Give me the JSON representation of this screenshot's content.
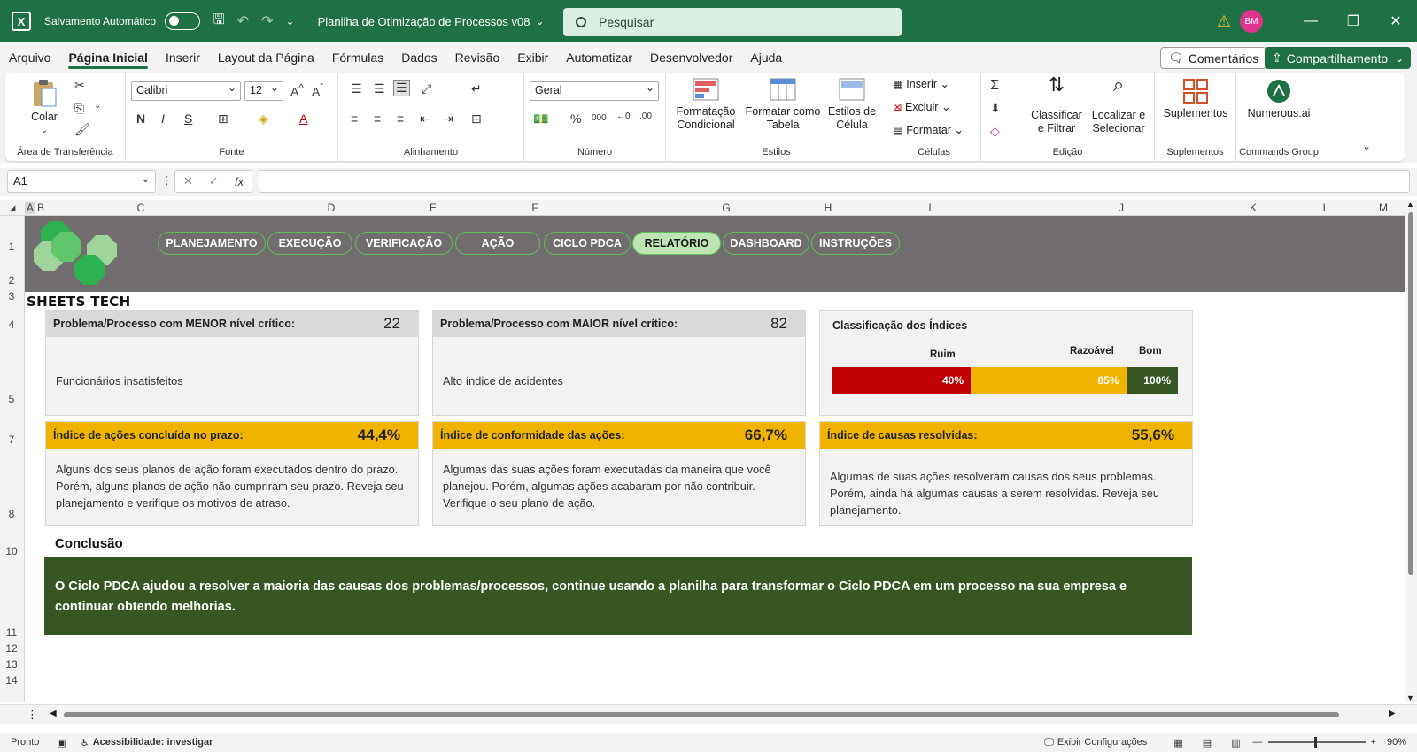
{
  "titlebar": {
    "autosave_label": "Salvamento Automático",
    "title": "Planilha de Otimização de Processos v08",
    "search_placeholder": "Pesquisar",
    "avatar_initials": "BM"
  },
  "menu": {
    "tabs": [
      "Arquivo",
      "Página Inicial",
      "Inserir",
      "Layout da Página",
      "Fórmulas",
      "Dados",
      "Revisão",
      "Exibir",
      "Automatizar",
      "Desenvolvedor",
      "Ajuda"
    ],
    "active": "Página Inicial",
    "comments": "Comentários",
    "share": "Compartilhamento"
  },
  "ribbon": {
    "clipboard": {
      "paste": "Colar",
      "label": "Área de Transferência"
    },
    "font": {
      "name": "Calibri",
      "size": "12",
      "bold": "N",
      "italic": "I",
      "underline": "S",
      "label": "Fonte"
    },
    "alignment": {
      "label": "Alinhamento"
    },
    "number": {
      "format": "Geral",
      "label": "Número"
    },
    "styles": {
      "conditional_1": "Formatação",
      "conditional_2": "Condicional",
      "table_1": "Formatar como",
      "table_2": "Tabela",
      "cell_1": "Estilos de",
      "cell_2": "Célula",
      "label": "Estilos"
    },
    "cells": {
      "insert": "Inserir",
      "delete": "Excluir",
      "format": "Formatar",
      "label": "Células"
    },
    "editing": {
      "sort_1": "Classificar",
      "sort_2": "e Filtrar",
      "find_1": "Localizar e",
      "find_2": "Selecionar",
      "label": "Edição"
    },
    "addins": {
      "btn": "Suplementos",
      "label": "Suplementos"
    },
    "commands": {
      "btn": "Numerous.ai",
      "label": "Commands Group"
    }
  },
  "formula_bar": {
    "name_box": "A1",
    "fx": "fx",
    "content": ""
  },
  "columns": [
    "A",
    "B",
    "C",
    "D",
    "E",
    "F",
    "G",
    "H",
    "I",
    "J",
    "K",
    "L",
    "M"
  ],
  "rows": [
    "1",
    "2",
    "3",
    "4",
    "5",
    "7",
    "8",
    "10",
    "11",
    "12",
    "13",
    "14"
  ],
  "sheet": {
    "brand": "SHEETS TECH",
    "nav": [
      "PLANEJAMENTO",
      "EXECUÇÃO",
      "VERIFICAÇÃO",
      "AÇÃO",
      "CICLO PDCA",
      "RELATÓRIO",
      "DASHBOARD",
      "INSTRUÇÕES"
    ],
    "nav_active": "RELATÓRIO",
    "min_card": {
      "title": "Problema/Processo com MENOR nível crítico:",
      "value": "22",
      "text": "Funcionários insatisfeitos"
    },
    "max_card": {
      "title": "Problema/Processo com MAIOR nível crítico:",
      "value": "82",
      "text": "Alto índice de acidentes"
    },
    "scale": {
      "title": "Classificação dos Índices",
      "labels": [
        "Ruim",
        "Razoável",
        "Bom"
      ],
      "segments": [
        {
          "value": "40%",
          "fraction": 0.4,
          "color": "#c00000"
        },
        {
          "value": "85%",
          "fraction": 0.85,
          "color": "#f0b400"
        },
        {
          "value": "100%",
          "fraction": 1.0,
          "color": "#375623"
        }
      ]
    },
    "kpi1": {
      "title": "Índice de ações concluída no prazo:",
      "value": "44,4%",
      "text": "Alguns dos seus planos de ação foram executados dentro do prazo. Porém, alguns planos de ação não cumpriram seu prazo. Reveja seu planejamento e verifique os motivos de atraso."
    },
    "kpi2": {
      "title": "Índice de conformidade das ações:",
      "value": "66,7%",
      "text": "Algumas das suas ações foram executadas da maneira que você planejou. Porém, algumas ações acabaram por não contribuir. Verifique o seu plano de ação."
    },
    "kpi3": {
      "title": "Índice de causas resolvidas:",
      "value": "55,6%",
      "text": "Algumas de suas ações resolveram causas dos seus problemas. Porém, ainda há algumas causas a serem resolvidas. Reveja seu planejamento."
    },
    "conclusion_title": "Conclusão",
    "conclusion": "O Ciclo PDCA ajudou a resolver a maioria das causas dos problemas/processos, continue usando a planilha para transformar o Ciclo PDCA em um processo na sua empresa e continuar obtendo melhorias."
  },
  "status": {
    "ready": "Pronto",
    "accessibility": "Acessibilidade: investigar",
    "display_settings": "Exibir Configurações",
    "zoom": "90%"
  }
}
